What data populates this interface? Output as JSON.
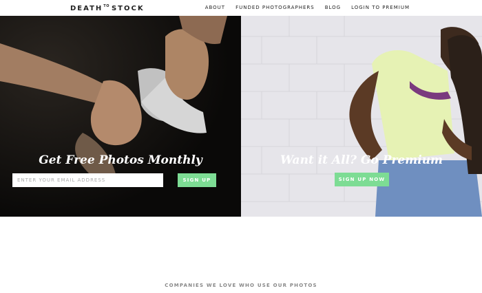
{
  "header": {
    "logo_left": "DEATH",
    "logo_mid": "TO",
    "logo_right": "STOCK",
    "nav": [
      "ABOUT",
      "FUNDED PHOTOGRAPHERS",
      "BLOG",
      "LOGIN TO PREMIUM"
    ]
  },
  "hero_left": {
    "title": "Get Free Photos Monthly",
    "email_placeholder": "ENTER YOUR EMAIL ADDRESS",
    "button": "SIGN UP"
  },
  "hero_right": {
    "title": "Want it All? Go Premium",
    "button": "SIGN UP NOW"
  },
  "companies": {
    "label": "COMPANIES WE LOVE WHO USE OUR PHOTOS"
  },
  "colors": {
    "accent": "#7ddc94",
    "left_bg": "#0b0a09",
    "right_bg": "#e4e3e8"
  }
}
